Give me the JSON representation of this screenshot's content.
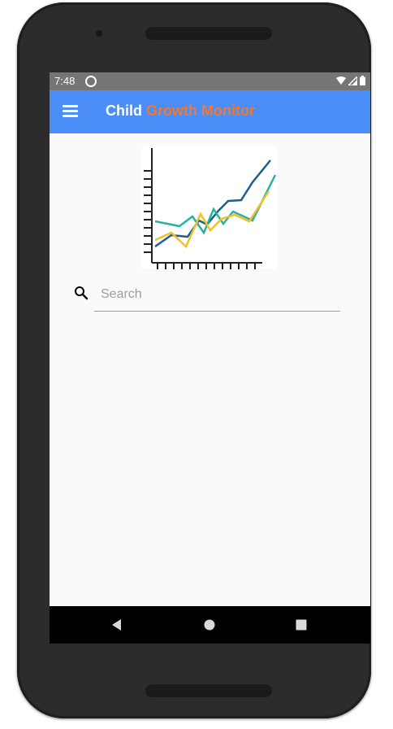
{
  "status_bar": {
    "time": "7:48",
    "icons": [
      "data-saver-icon",
      "wifi-icon",
      "signal-icon",
      "battery-icon"
    ]
  },
  "app_bar": {
    "title_part1": "Child ",
    "title_part2": "Growth Monitor",
    "title_colors": {
      "part1": "#ffffff",
      "part2": "#f3772d"
    },
    "background": "#4c8ef7",
    "menu_icon": "hamburger-menu-icon"
  },
  "logo": {
    "icon": "line-chart-logo-icon",
    "line_colors": [
      "#1d5f8a",
      "#26b3a0",
      "#f4bf2a"
    ]
  },
  "search": {
    "placeholder": "Search",
    "value": "",
    "icon": "search-icon"
  },
  "navigation": {
    "buttons": [
      "back-icon",
      "home-icon",
      "recents-icon"
    ]
  }
}
